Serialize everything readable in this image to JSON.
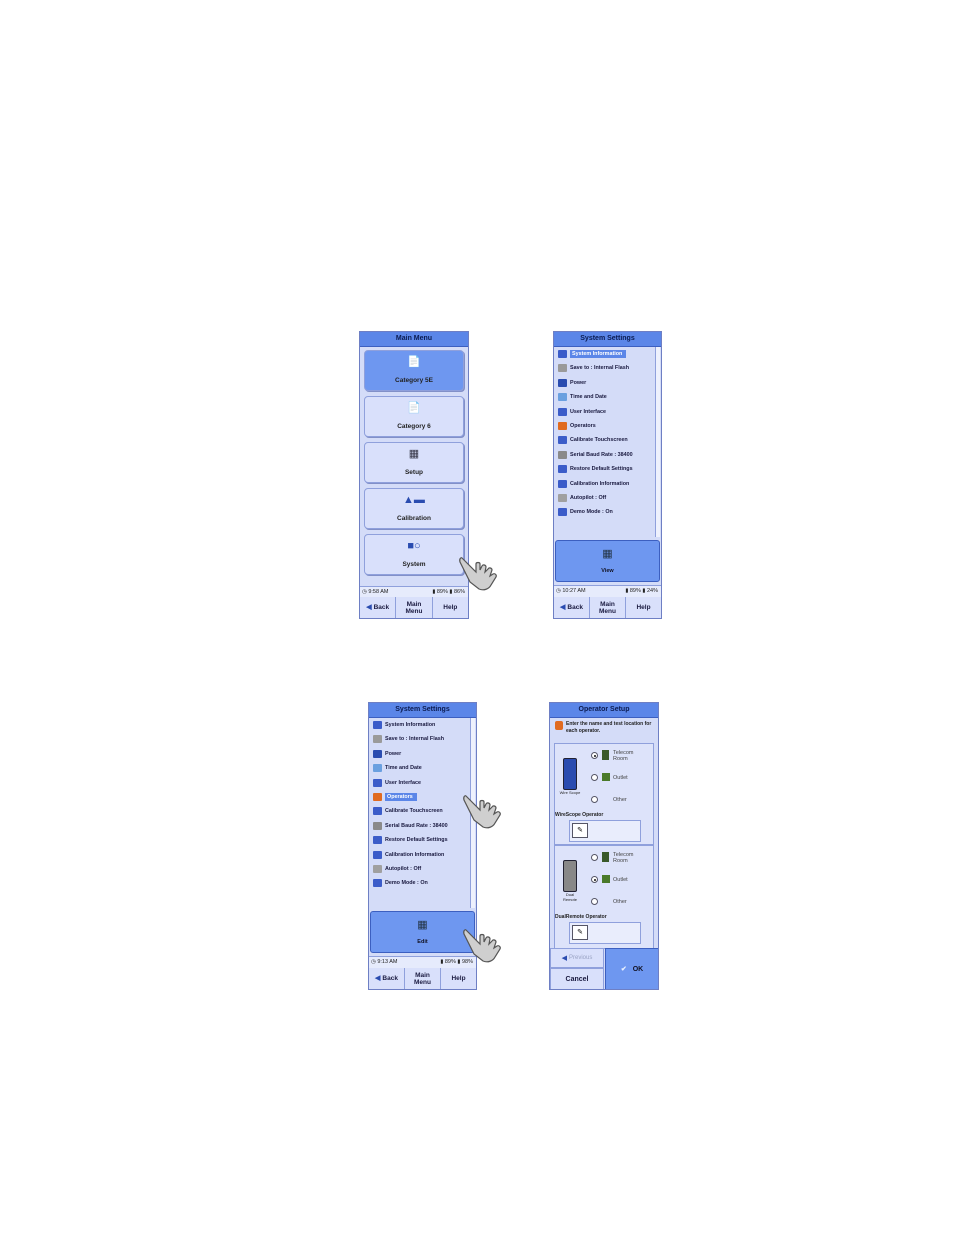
{
  "screen1": {
    "title": "Main Menu",
    "buttons": [
      {
        "label": "Category 5E",
        "icon": "document-icon"
      },
      {
        "label": "Category 6",
        "icon": "document-icon"
      },
      {
        "label": "Setup",
        "icon": "device-icon"
      },
      {
        "label": "Calibration",
        "icon": "calibration-icon"
      },
      {
        "label": "System",
        "icon": "system-icon"
      }
    ],
    "status": {
      "time": "9:58 AM",
      "battery": "89%",
      "battery2": "86%"
    },
    "nav": {
      "back": "Back",
      "main_menu": "Main Menu",
      "help": "Help"
    }
  },
  "screen2": {
    "title": "System Settings",
    "items": [
      "System Information",
      "Save to : Internal Flash",
      "Power",
      "Time and Date",
      "User Interface",
      "Operators",
      "Calibrate Touchscreen",
      "Serial Baud Rate : 38400",
      "Restore Default Settings",
      "Calibration Information",
      "Autopilot : Off",
      "Demo Mode : On"
    ],
    "action_label": "View",
    "status": {
      "time": "10:27 AM",
      "battery": "89%",
      "battery2": "24%"
    },
    "nav": {
      "back": "Back",
      "main_menu": "Main Menu",
      "help": "Help"
    }
  },
  "screen3": {
    "title": "System Settings",
    "items": [
      "System Information",
      "Save to : Internal Flash",
      "Power",
      "Time and Date",
      "User Interface",
      "Operators",
      "Calibrate Touchscreen",
      "Serial Baud Rate : 38400",
      "Restore Default Settings",
      "Calibration Information",
      "Autopilot : Off",
      "Demo Mode : On"
    ],
    "action_label": "Edit",
    "status": {
      "time": "9:13 AM",
      "battery": "89%",
      "battery2": "98%"
    },
    "nav": {
      "back": "Back",
      "main_menu": "Main Menu",
      "help": "Help"
    }
  },
  "screen4": {
    "title": "Operator Setup",
    "instructions": "Enter the name and test location for each operator.",
    "group1": {
      "device_label": "Wire Scope",
      "options": [
        "Telecom Room",
        "Outlet",
        "Other"
      ],
      "selected": 0,
      "field_label": "WireScope Operator"
    },
    "group2": {
      "device_label": "Dual Remote",
      "options": [
        "Telecom Room",
        "Outlet",
        "Other"
      ],
      "selected": 1,
      "field_label": "DualRemote Operator"
    },
    "buttons": {
      "previous": "Previous",
      "cancel": "Cancel",
      "ok": "OK"
    }
  },
  "colors": {
    "screen_bg": "#d4dcf8",
    "title_bar": "#5b86e8",
    "selected": "#6e97f0"
  }
}
